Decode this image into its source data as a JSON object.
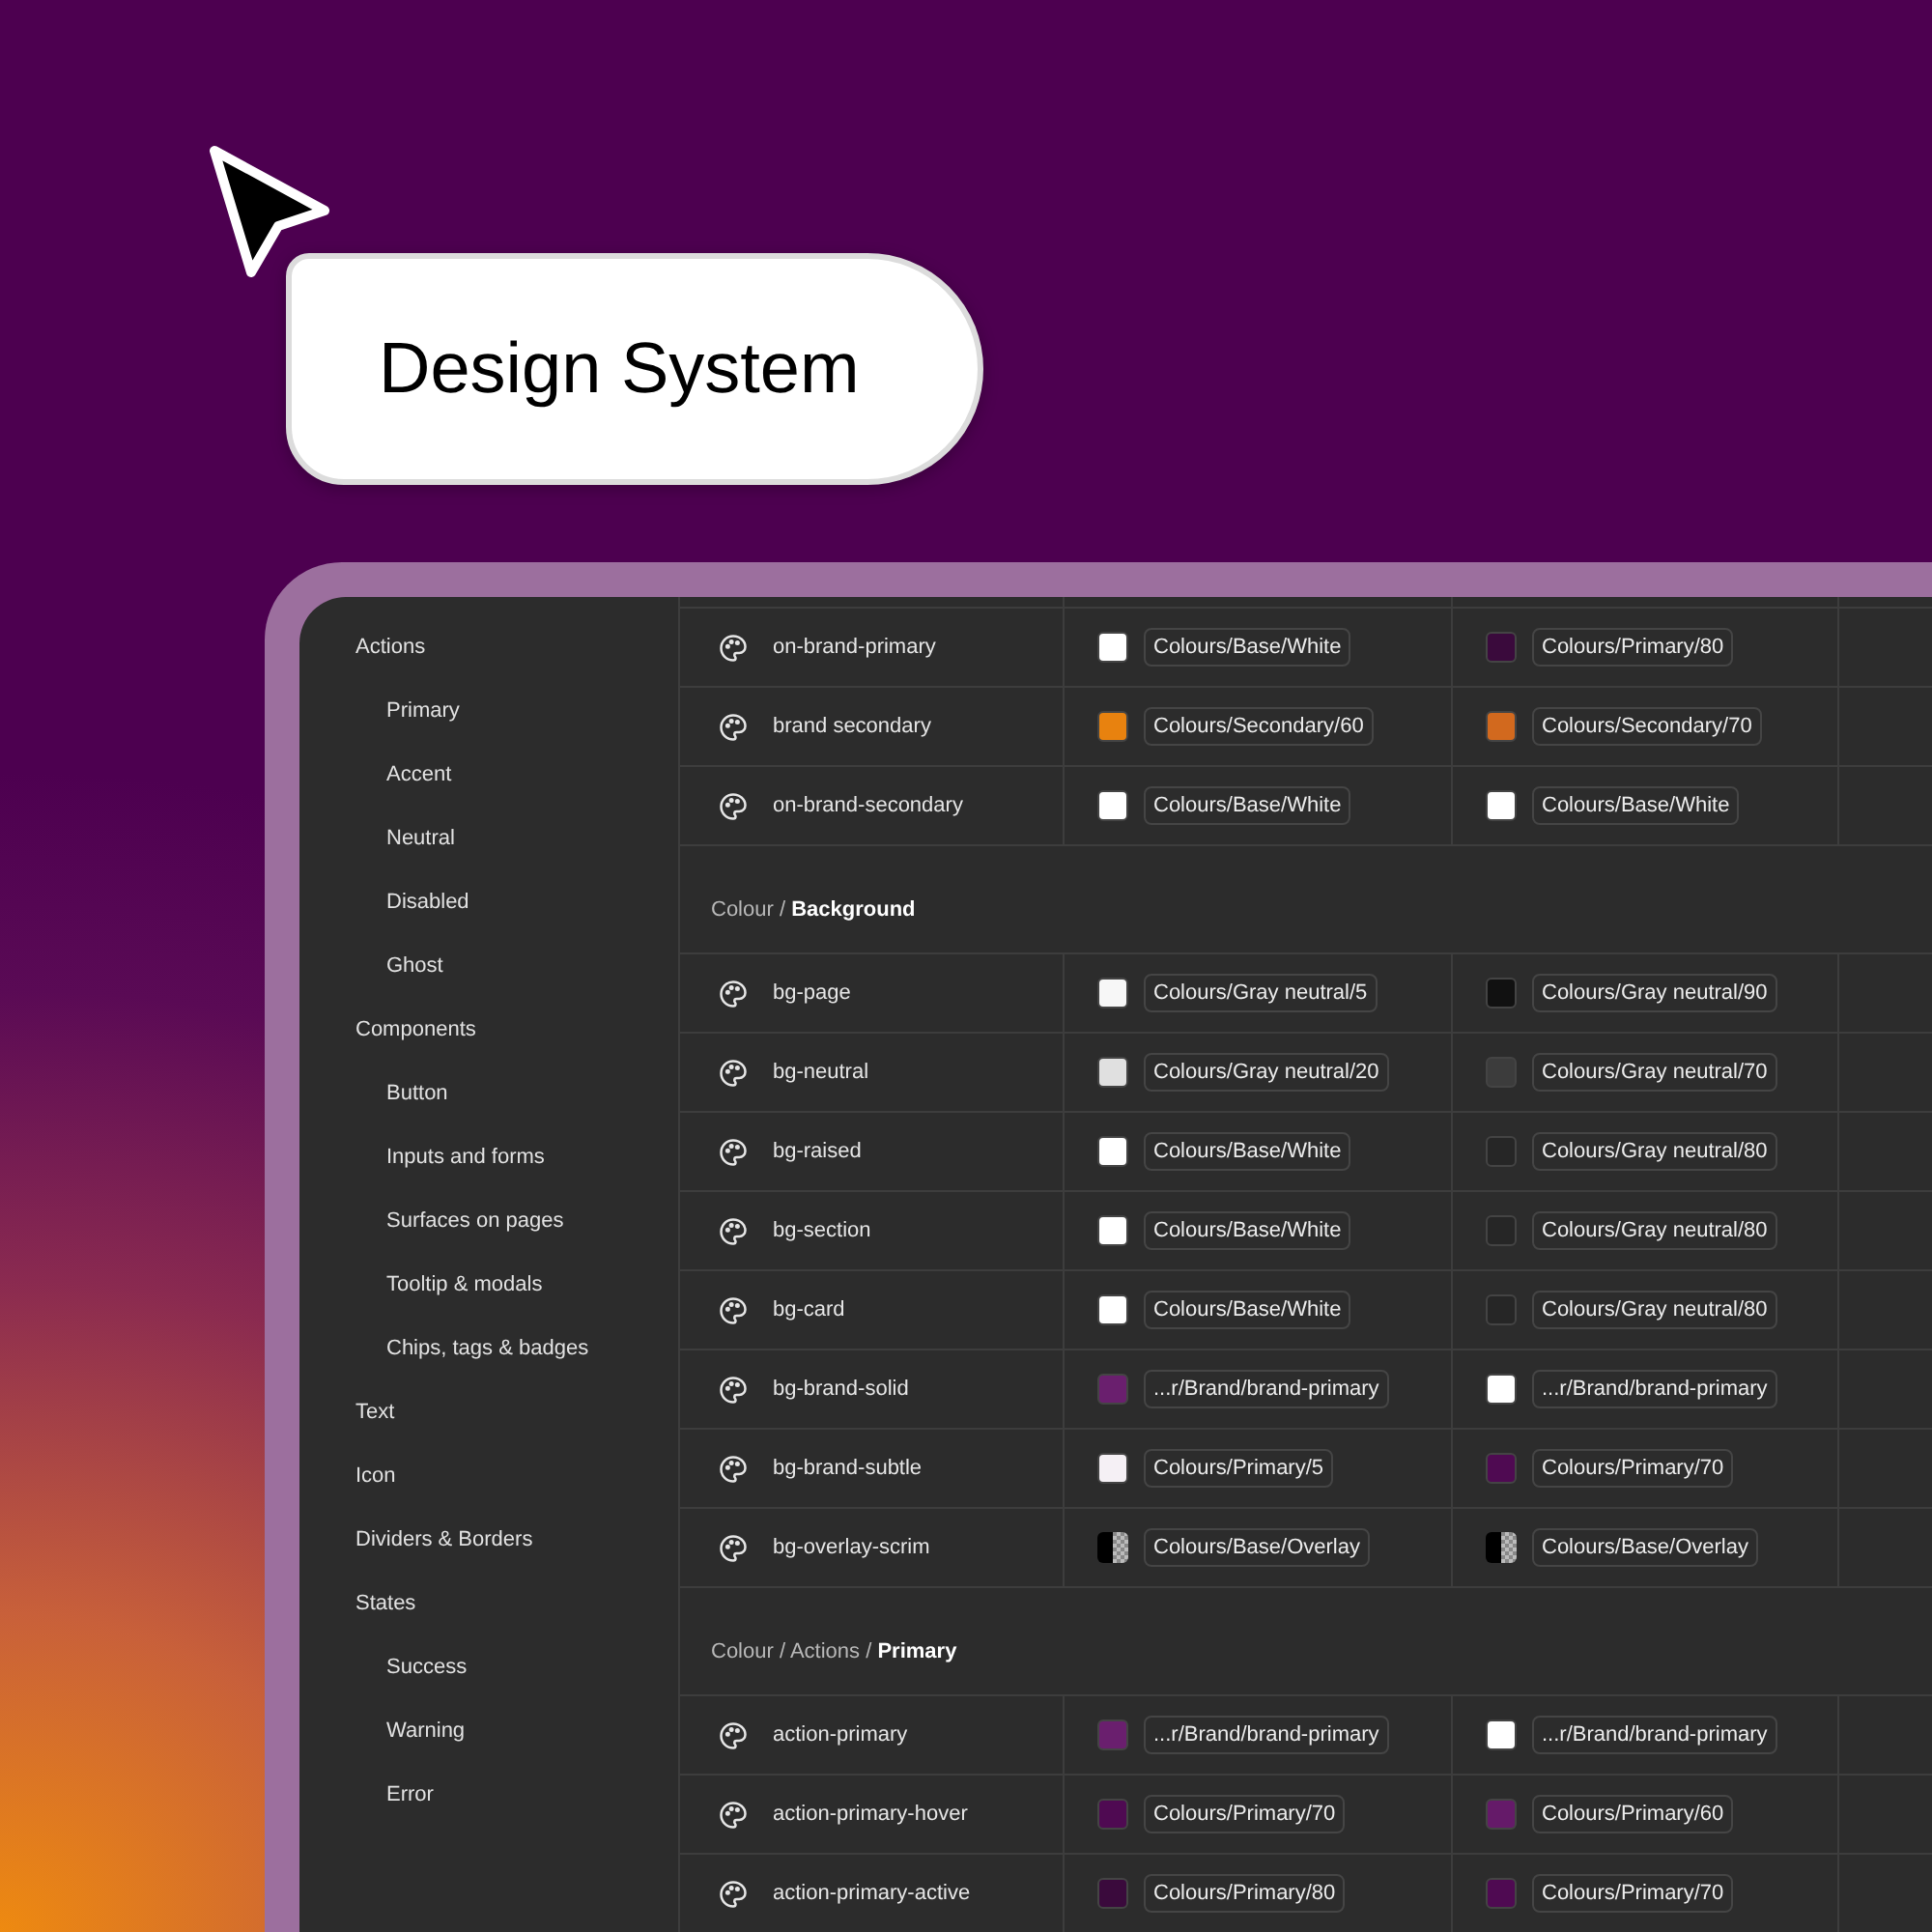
{
  "badge": {
    "label": "Design System"
  },
  "sidebar": {
    "items": [
      {
        "label": "Actions",
        "children": [
          {
            "label": "Primary"
          },
          {
            "label": "Accent"
          },
          {
            "label": "Neutral"
          },
          {
            "label": "Disabled"
          },
          {
            "label": "Ghost"
          }
        ]
      },
      {
        "label": "Components",
        "children": [
          {
            "label": "Button"
          },
          {
            "label": "Inputs and forms"
          },
          {
            "label": "Surfaces on pages"
          },
          {
            "label": "Tooltip & modals"
          },
          {
            "label": "Chips, tags & badges"
          }
        ]
      },
      {
        "label": "Text"
      },
      {
        "label": "Icon"
      },
      {
        "label": "Dividers & Borders"
      },
      {
        "label": "States",
        "children": [
          {
            "label": "Success"
          },
          {
            "label": "Warning"
          },
          {
            "label": "Error"
          }
        ]
      }
    ]
  },
  "sections": [
    {
      "rows": [
        {
          "token": "on-brand-primary",
          "light": {
            "kind": "solid",
            "color": "#ffffff",
            "label": "Colours/Base/White"
          },
          "dark": {
            "kind": "solid",
            "color": "#3a0a3c",
            "label": "Colours/Primary/80"
          }
        },
        {
          "token": "brand secondary",
          "light": {
            "kind": "solid",
            "color": "#e8820f",
            "label": "Colours/Secondary/60"
          },
          "dark": {
            "kind": "solid",
            "color": "#d2691e",
            "label": "Colours/Secondary/70"
          }
        },
        {
          "token": "on-brand-secondary",
          "light": {
            "kind": "solid",
            "color": "#ffffff",
            "label": "Colours/Base/White"
          },
          "dark": {
            "kind": "solid",
            "color": "#ffffff",
            "label": "Colours/Base/White"
          }
        }
      ]
    },
    {
      "title": "Colour / **Background**",
      "rows": [
        {
          "token": "bg-page",
          "light": {
            "kind": "solid",
            "color": "#f7f7f7",
            "label": "Colours/Gray neutral/5"
          },
          "dark": {
            "kind": "solid",
            "color": "#111111",
            "label": "Colours/Gray neutral/90"
          }
        },
        {
          "token": "bg-neutral",
          "light": {
            "kind": "solid",
            "color": "#e0e0e0",
            "label": "Colours/Gray neutral/20"
          },
          "dark": {
            "kind": "solid",
            "color": "#3c3c3c",
            "label": "Colours/Gray neutral/70"
          }
        },
        {
          "token": "bg-raised",
          "light": {
            "kind": "solid",
            "color": "#ffffff",
            "label": "Colours/Base/White"
          },
          "dark": {
            "kind": "solid",
            "color": "#262626",
            "label": "Colours/Gray neutral/80"
          }
        },
        {
          "token": "bg-section",
          "light": {
            "kind": "solid",
            "color": "#ffffff",
            "label": "Colours/Base/White"
          },
          "dark": {
            "kind": "solid",
            "color": "#262626",
            "label": "Colours/Gray neutral/80"
          }
        },
        {
          "token": "bg-card",
          "light": {
            "kind": "solid",
            "color": "#ffffff",
            "label": "Colours/Base/White"
          },
          "dark": {
            "kind": "solid",
            "color": "#262626",
            "label": "Colours/Gray neutral/80"
          }
        },
        {
          "token": "bg-brand-solid",
          "light": {
            "kind": "solid",
            "color": "#6a1f6e",
            "label": "...r/Brand/brand-primary"
          },
          "dark": {
            "kind": "solid",
            "color": "#ffffff",
            "label": "...r/Brand/brand-primary"
          }
        },
        {
          "token": "bg-brand-subtle",
          "light": {
            "kind": "solid",
            "color": "#f5f0f5",
            "label": "Colours/Primary/5"
          },
          "dark": {
            "kind": "solid",
            "color": "#4f0a52",
            "label": "Colours/Primary/70"
          }
        },
        {
          "token": "bg-overlay-scrim",
          "light": {
            "kind": "overlay",
            "color": "#000000",
            "label": "Colours/Base/Overlay"
          },
          "dark": {
            "kind": "overlay",
            "color": "#000000",
            "label": "Colours/Base/Overlay"
          }
        }
      ]
    },
    {
      "title": "Colour / Actions / **Primary**",
      "rows": [
        {
          "token": "action-primary",
          "light": {
            "kind": "solid",
            "color": "#6a1f6e",
            "label": "...r/Brand/brand-primary"
          },
          "dark": {
            "kind": "solid",
            "color": "#ffffff",
            "label": "...r/Brand/brand-primary"
          }
        },
        {
          "token": "action-primary-hover",
          "light": {
            "kind": "solid",
            "color": "#4f0a52",
            "label": "Colours/Primary/70"
          },
          "dark": {
            "kind": "solid",
            "color": "#651a69",
            "label": "Colours/Primary/60"
          }
        },
        {
          "token": "action-primary-active",
          "light": {
            "kind": "solid",
            "color": "#3a0a3c",
            "label": "Colours/Primary/80"
          },
          "dark": {
            "kind": "solid",
            "color": "#4f0a52",
            "label": "Colours/Primary/70"
          }
        }
      ]
    }
  ]
}
